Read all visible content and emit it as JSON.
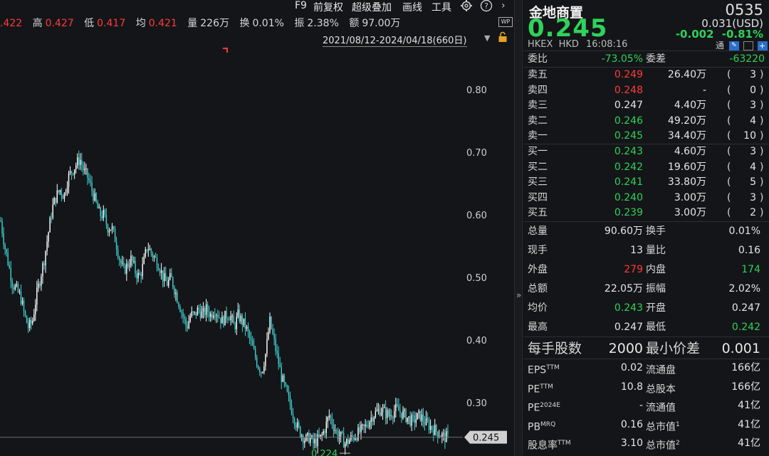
{
  "toolbar": {
    "items": [
      "F9",
      "前复权",
      "超级叠加",
      "画线",
      "工具"
    ],
    "gear_icon": "gear-icon",
    "help_icon": "help-icon",
    "chevron_icon": "chevron-right-icon"
  },
  "stats": {
    "open_value": ".422",
    "high_label": "高",
    "high_value": "0.427",
    "low_label": "低",
    "low_value": "0.417",
    "avg_label": "均",
    "avg_value": "0.421",
    "volume_label": "量",
    "volume_value": "226万",
    "turnover_label": "换",
    "turnover_value": "0.01%",
    "amplitude_label": "振",
    "amplitude_value": "2.38%",
    "amount_label": "额",
    "amount_value": "97.00万"
  },
  "date_range": "2021/08/12-2024/04/18(660日)",
  "wp_badge": "WP",
  "chart_data": {
    "type": "candlestick",
    "y_ticks": [
      "0.80",
      "0.70",
      "0.60",
      "0.50",
      "0.40",
      "0.30"
    ],
    "ylim": [
      0.215,
      0.875
    ],
    "current_price_label": "0.245",
    "min_label": "0.224",
    "series_close": [
      0.59,
      0.55,
      0.52,
      0.49,
      0.48,
      0.47,
      0.44,
      0.42,
      0.43,
      0.47,
      0.5,
      0.53,
      0.57,
      0.61,
      0.63,
      0.64,
      0.63,
      0.66,
      0.67,
      0.68,
      0.69,
      0.67,
      0.66,
      0.64,
      0.62,
      0.6,
      0.6,
      0.58,
      0.58,
      0.56,
      0.53,
      0.51,
      0.52,
      0.53,
      0.51,
      0.5,
      0.52,
      0.55,
      0.54,
      0.53,
      0.52,
      0.5,
      0.49,
      0.5,
      0.48,
      0.46,
      0.44,
      0.42,
      0.44,
      0.44,
      0.45,
      0.44,
      0.45,
      0.44,
      0.45,
      0.44,
      0.43,
      0.44,
      0.44,
      0.42,
      0.44,
      0.43,
      0.42,
      0.4,
      0.38,
      0.36,
      0.35,
      0.38,
      0.43,
      0.4,
      0.37,
      0.34,
      0.32,
      0.3,
      0.28,
      0.26,
      0.25,
      0.24,
      0.245,
      0.235,
      0.24,
      0.245,
      0.26,
      0.28,
      0.265,
      0.25,
      0.245,
      0.235,
      0.24,
      0.245,
      0.25,
      0.255,
      0.26,
      0.27,
      0.28,
      0.285,
      0.29,
      0.285,
      0.28,
      0.285,
      0.29,
      0.285,
      0.28,
      0.275,
      0.27,
      0.275,
      0.28,
      0.27,
      0.265,
      0.26,
      0.255,
      0.25,
      0.245,
      0.245
    ]
  },
  "panel": {
    "name": "金地商置",
    "code": "0535",
    "price": "0.245",
    "usd": "0.031(USD)",
    "change": "-0.002",
    "change_pct": "-0.81%",
    "market": "HKEX",
    "currency": "HKD",
    "time": "16:08:16",
    "tong": "通",
    "weibi_label": "委比",
    "weibi_value": "-73.05%",
    "weicha_label": "委差",
    "weicha_value": "-63220",
    "asks": [
      {
        "label": "卖五",
        "price": "0.249",
        "vol": "26.40万",
        "count": "3",
        "color": "red"
      },
      {
        "label": "卖四",
        "price": "0.248",
        "vol": "-",
        "count": "0",
        "color": "red"
      },
      {
        "label": "卖三",
        "price": "0.247",
        "vol": "4.40万",
        "count": "3",
        "color": "white"
      },
      {
        "label": "卖二",
        "price": "0.246",
        "vol": "49.20万",
        "count": "4",
        "color": "green"
      },
      {
        "label": "卖一",
        "price": "0.245",
        "vol": "34.40万",
        "count": "10",
        "color": "green"
      }
    ],
    "bids": [
      {
        "label": "买一",
        "price": "0.243",
        "vol": "4.60万",
        "count": "3",
        "color": "green"
      },
      {
        "label": "买二",
        "price": "0.242",
        "vol": "19.60万",
        "count": "4",
        "color": "green"
      },
      {
        "label": "买三",
        "price": "0.241",
        "vol": "33.80万",
        "count": "5",
        "color": "green"
      },
      {
        "label": "买四",
        "price": "0.240",
        "vol": "3.00万",
        "count": "3",
        "color": "green"
      },
      {
        "label": "买五",
        "price": "0.239",
        "vol": "3.00万",
        "count": "2",
        "color": "green"
      }
    ],
    "info": [
      {
        "l1": "总量",
        "v1": "90.60万",
        "c1": "white",
        "l2": "换手",
        "v2": "0.01%",
        "c2": "white"
      },
      {
        "l1": "现手",
        "v1": "13",
        "c1": "white",
        "l2": "量比",
        "v2": "0.16",
        "c2": "white"
      },
      {
        "l1": "外盘",
        "v1": "279",
        "c1": "red",
        "l2": "内盘",
        "v2": "174",
        "c2": "green"
      },
      {
        "l1": "总额",
        "v1": "22.05万",
        "c1": "white",
        "l2": "振幅",
        "v2": "2.02%",
        "c2": "white"
      },
      {
        "l1": "均价",
        "v1": "0.243",
        "c1": "green",
        "l2": "开盘",
        "v2": "0.247",
        "c2": "white"
      },
      {
        "l1": "最高",
        "v1": "0.247",
        "c1": "white",
        "l2": "最低",
        "v2": "0.242",
        "c2": "green"
      }
    ],
    "lot_label": "每手股数",
    "lot_value": "2000",
    "tick_label": "最小价差",
    "tick_value": "0.001",
    "fund": [
      {
        "l1": "EPS",
        "s1": "TTM",
        "v1": "0.02",
        "l2": "流通盘",
        "s2": "",
        "v2": "166亿"
      },
      {
        "l1": "PE",
        "s1": "TTM",
        "v1": "10.8",
        "l2": "总股本",
        "s2": "",
        "v2": "166亿"
      },
      {
        "l1": "PE",
        "s1": "2024E",
        "v1": "-",
        "l2": "流通值",
        "s2": "",
        "v2": "41亿"
      },
      {
        "l1": "PB",
        "s1": "MRQ",
        "v1": "0.16",
        "l2": "总市值",
        "s2": "1",
        "v2": "41亿"
      },
      {
        "l1": "股息率",
        "s1": "TTM",
        "v1": "3.10",
        "l2": "总市值",
        "s2": "2",
        "v2": "41亿"
      }
    ],
    "colors": {
      "red": "#ff3b3b",
      "green": "#2fd25a",
      "white": "#e6e6e6"
    }
  }
}
